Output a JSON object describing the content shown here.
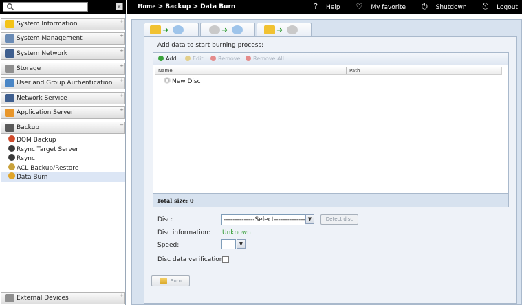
{
  "topbar": {
    "breadcrumb_home": "Home",
    "breadcrumb_rest": " > Backup > Data Burn",
    "help": "Help",
    "favorite": "My favorite",
    "shutdown": "Shutdown",
    "logout": "Logout"
  },
  "sidebar": {
    "collapse_glyph": "«",
    "expand_glyph": "+",
    "collapse_section_glyph": "−",
    "sections": [
      {
        "label": "System Information",
        "icon": "info-icon",
        "color": "#f3c318"
      },
      {
        "label": "System Management",
        "icon": "tools-icon",
        "color": "#6a8bb5"
      },
      {
        "label": "System Network",
        "icon": "network-icon",
        "color": "#3f5f8f"
      },
      {
        "label": "Storage",
        "icon": "storage-icon",
        "color": "#8f8f8f"
      },
      {
        "label": "User and Group Authentication",
        "icon": "users-icon",
        "color": "#4a86c6"
      },
      {
        "label": "Network Service",
        "icon": "service-icon",
        "color": "#3f5f8f"
      },
      {
        "label": "Application Server",
        "icon": "app-server-icon",
        "color": "#e8962a"
      },
      {
        "label": "Backup",
        "icon": "backup-icon",
        "color": "#5a5a5a"
      },
      {
        "label": "External Devices",
        "icon": "external-devices-icon",
        "color": "#8f8f8f"
      }
    ],
    "backup_items": [
      {
        "label": "DOM Backup",
        "icon": "dom-backup-icon",
        "color": "#d04a2a"
      },
      {
        "label": "Rsync Target Server",
        "icon": "rsync-target-icon",
        "color": "#3a3a3a"
      },
      {
        "label": "Rsync",
        "icon": "rsync-icon",
        "color": "#3a3a3a"
      },
      {
        "label": "ACL Backup/Restore",
        "icon": "acl-icon",
        "color": "#c9a23c"
      },
      {
        "label": "Data Burn",
        "icon": "data-burn-icon",
        "color": "#e0a52a"
      }
    ]
  },
  "main": {
    "add_data_label": "Add data to start burning process:",
    "toolbar": {
      "add": "Add",
      "edit": "Edit",
      "remove": "Remove",
      "remove_all": "Remove All"
    },
    "columns": {
      "name": "Name",
      "path": "Path"
    },
    "rows": [
      {
        "name": "New Disc",
        "path": ""
      }
    ],
    "total_size": "Total size: 0",
    "form": {
      "disc_label": "Disc:",
      "disc_value": "--------------Select---------------",
      "detect_label": "Detect disc",
      "disc_info_label": "Disc information:",
      "disc_info_value": "Unknown",
      "speed_label": "Speed:",
      "verify_label": "Disc data verification:",
      "burn_label": "Burn"
    },
    "colors": {
      "accent_green": "#2e9a2e",
      "panel_bg": "#d7e2ef",
      "topbar_bg": "#000000"
    }
  }
}
